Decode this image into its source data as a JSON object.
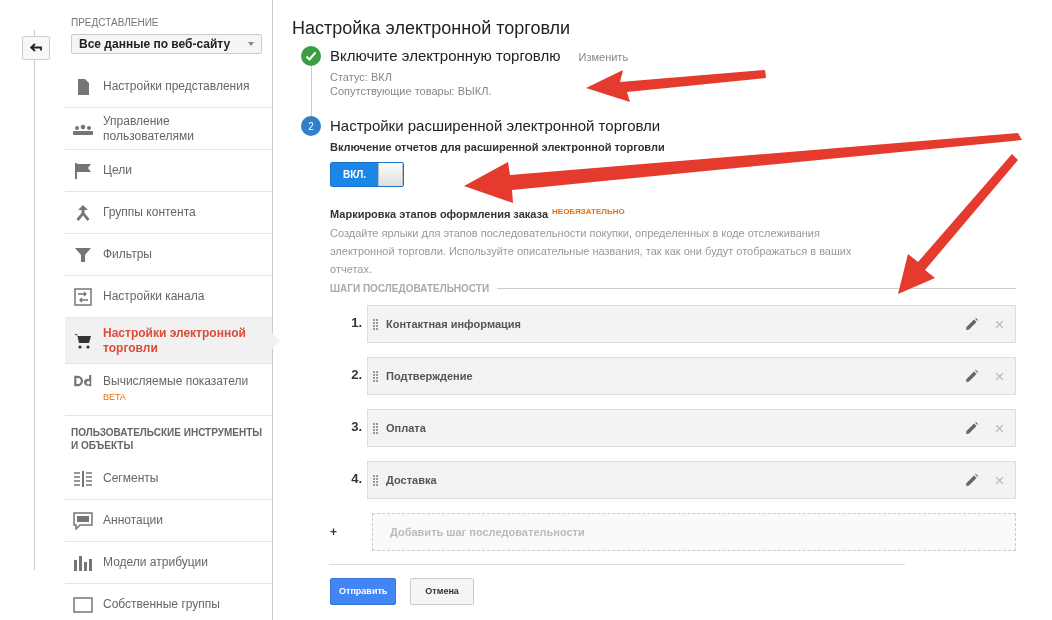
{
  "sidebar": {
    "view_label": "ПРЕДСТАВЛЕНИЕ",
    "view_select": {
      "value": "Все данные по веб-сайту"
    },
    "items": [
      {
        "label": "Настройки представления",
        "selected": false
      },
      {
        "label": "Управление пользователями",
        "selected": false
      },
      {
        "label": "Цели",
        "selected": false
      },
      {
        "label": "Группы контента",
        "selected": false
      },
      {
        "label": "Фильтры",
        "selected": false
      },
      {
        "label": "Настройки канала",
        "selected": false
      },
      {
        "label": "Настройки электронной торговли",
        "selected": true
      },
      {
        "label": "Вычисляемые показатели",
        "selected": false,
        "badge": "BETA"
      }
    ],
    "section_title": "ПОЛЬЗОВАТЕЛЬСКИЕ ИНСТРУМЕНТЫ И ОБЪЕКТЫ",
    "tool_items": [
      {
        "label": "Сегменты",
        "selected": false
      },
      {
        "label": "Аннотации",
        "selected": false
      },
      {
        "label": "Модели атрибуции",
        "selected": false
      },
      {
        "label": "Собственные группы",
        "selected": false
      }
    ]
  },
  "main": {
    "title": "Настройка электронной торговли",
    "steps": [
      {
        "kind": "done",
        "title": "Включите электронную торговлю",
        "link": "Изменить",
        "lines": [
          "Статус: ВКЛ",
          "Сопутствующие товары: ВЫКЛ."
        ]
      },
      {
        "kind": "active",
        "number": "2",
        "title": "Настройки расширенной электронной торговли"
      }
    ],
    "toggle_label": "Включение отчетов для расширенной электронной торговли",
    "toggle": {
      "on": true,
      "label": "ВКЛ."
    },
    "funnel_label": "Маркировка этапов оформления заказа",
    "funnel_badge": "НЕОБЯЗАТЕЛЬНО",
    "funnel_description": "Создайте ярлыки для этапов последовательности покупки, определенных в коде отслеживания электронной торговли. Используйте описательные названия, так как они будут отображаться в ваших отчетах.",
    "section_title": "ШАГИ ПОСЛЕДОВАТЕЛЬНОСТИ",
    "funnel_steps": [
      {
        "number": "1.",
        "name": "Контактная информация"
      },
      {
        "number": "2.",
        "name": "Подтверждение"
      },
      {
        "number": "3.",
        "name": "Оплата"
      },
      {
        "number": "4.",
        "name": "Доставка"
      }
    ],
    "add_step": {
      "plus": "+",
      "placeholder": "Добавить шаг последовательности"
    },
    "buttons": [
      {
        "label": "Отправить",
        "kind": "primary"
      },
      {
        "label": "Отмена",
        "kind": "secondary"
      }
    ]
  }
}
